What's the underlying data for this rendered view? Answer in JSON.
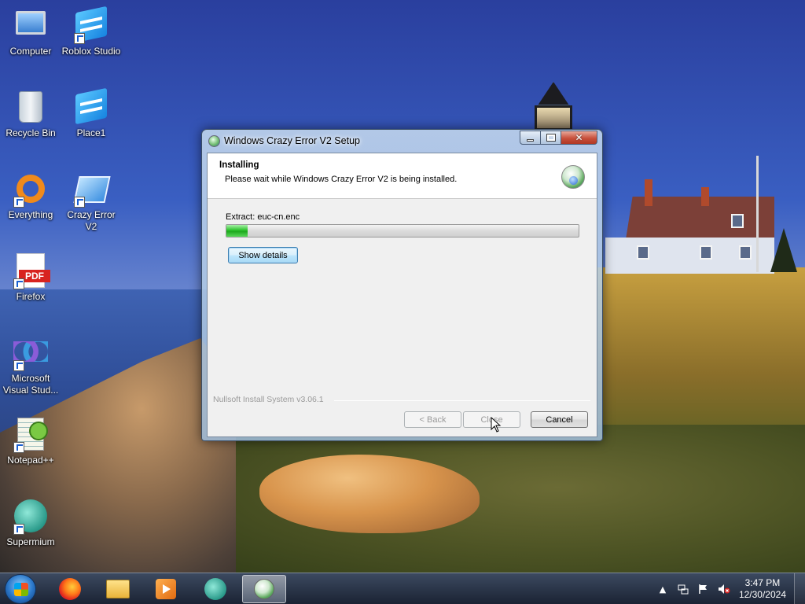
{
  "desktop": {
    "icons": [
      {
        "label": "Computer",
        "icon": "computer-icon",
        "shortcut": false
      },
      {
        "label": "Roblox Studio",
        "icon": "roblox-studio-icon",
        "shortcut": true
      },
      {
        "label": "Recycle Bin",
        "icon": "recycle-bin-icon",
        "shortcut": false
      },
      {
        "label": "Place1",
        "icon": "roblox-place-icon",
        "shortcut": false
      },
      {
        "label": "Everything",
        "icon": "everything-search-icon",
        "shortcut": true
      },
      {
        "label": "Crazy Error V2",
        "icon": "crazy-error-icon",
        "shortcut": true
      },
      {
        "label": "Firefox",
        "icon": "pdf-file-icon",
        "shortcut": true,
        "badge": "PDF"
      },
      {
        "label": "Microsoft Visual Stud...",
        "icon": "visual-studio-icon",
        "shortcut": true
      },
      {
        "label": "Notepad++",
        "icon": "notepad-plus-plus-icon",
        "shortcut": true
      },
      {
        "label": "Supermium",
        "icon": "supermium-icon",
        "shortcut": true
      }
    ]
  },
  "installer": {
    "window_title": "Windows Crazy Error V2 Setup",
    "header_title": "Installing",
    "header_subtitle": "Please wait while Windows Crazy Error V2 is being installed.",
    "status_text": "Extract: euc-cn.enc",
    "progress_fraction": 0.06,
    "show_details_label": "Show details",
    "branding": "Nullsoft Install System v3.06.1",
    "back_label": "< Back",
    "close_label": "Close",
    "cancel_label": "Cancel",
    "colors": {
      "progress": "#2cc22c",
      "close_button": "#c8503c"
    }
  },
  "taskbar": {
    "pinned": [
      {
        "name": "firefox-icon"
      },
      {
        "name": "file-explorer-icon"
      },
      {
        "name": "media-player-icon"
      },
      {
        "name": "supermium-icon"
      },
      {
        "name": "installer-icon",
        "active": true
      }
    ],
    "tray": {
      "time": "3:47 PM",
      "date": "12/30/2024",
      "icons": [
        "show-hidden-icons-chevron",
        "network-icon",
        "action-center-flag-icon",
        "volume-muted-icon"
      ]
    }
  }
}
